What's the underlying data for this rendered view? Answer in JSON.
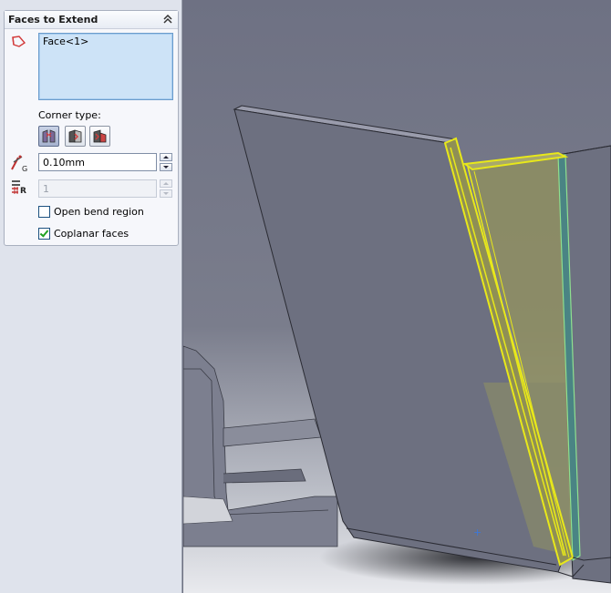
{
  "panel": {
    "group_title": "Faces to Extend",
    "faces_list": [
      "Face<1>"
    ],
    "corner_type_label": "Corner type:",
    "corner_types": [
      {
        "icon": "corner-open-icon",
        "selected": true
      },
      {
        "icon": "corner-closed-icon",
        "selected": false
      },
      {
        "icon": "corner-overlap-icon",
        "selected": false
      }
    ],
    "gap_distance": "0.10mm",
    "overlap_ratio": "1",
    "open_bend_region": {
      "label": "Open bend region",
      "checked": false
    },
    "coplanar_faces": {
      "label": "Coplanar faces",
      "checked": true
    }
  },
  "viewport": {
    "origin_marker": "+",
    "highlight_color": "#e8e81a",
    "body_color": "#6d7080"
  }
}
